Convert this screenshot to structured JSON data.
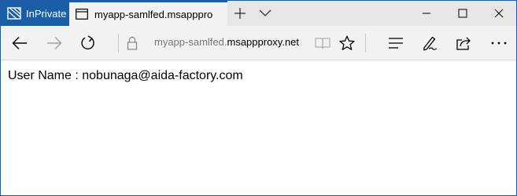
{
  "browser": {
    "inprivate_label": "InPrivate",
    "tab": {
      "title": "myapp-samlfed.msappproxy.net"
    },
    "address": {
      "subdomain": "myapp-samlfed.",
      "host": "msappproxy.net"
    },
    "icons": {
      "inprivate": "inprivate-icon",
      "tab_page": "page-icon",
      "new_tab": "plus-icon",
      "tab_list": "chevron-down-icon",
      "minimize": "minimize-icon",
      "maximize": "maximize-icon",
      "close": "close-icon",
      "back": "arrow-left-icon",
      "forward": "arrow-right-icon",
      "refresh": "refresh-icon",
      "lock": "lock-icon",
      "reading_view": "book-icon",
      "favorite": "star-icon",
      "hub": "hub-icon",
      "web_note": "pen-icon",
      "share": "share-icon",
      "more": "more-icon"
    },
    "colors": {
      "accent": "#1a5ea8",
      "chrome": "#f2f2f2",
      "titlebar": "#e6e6e6"
    }
  },
  "page": {
    "user_line": "User Name : nobunaga@aida-factory.com"
  }
}
